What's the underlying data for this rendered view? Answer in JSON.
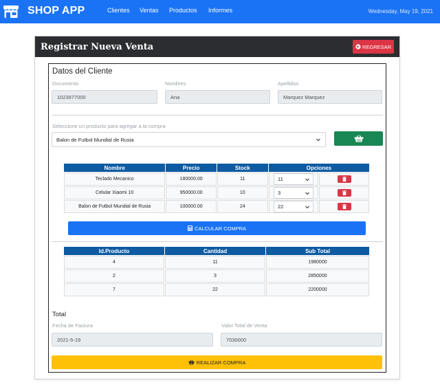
{
  "navbar": {
    "brand": "SHOP APP",
    "links": [
      "Clientes",
      "Ventas",
      "Productos",
      "Informes"
    ],
    "date": "Wednesday, May 19, 2021",
    "color": "#1a73f5"
  },
  "header": {
    "title": "Registrar Nueva Venta",
    "back_label": "REGRESAR"
  },
  "cliente": {
    "title": "Datos del Cliente",
    "documento_label": "Documento",
    "documento_value": "1023977000",
    "nombres_label": "Nombres",
    "nombres_value": "Ana",
    "apellidos_label": "Apellidos",
    "apellidos_value": "Marquez Marquez"
  },
  "producto_select": {
    "label": "Seleccione un producto para agregar a la compra",
    "selected": "Balon de Futbol Mundial de Rusia"
  },
  "productos_table": {
    "headers": [
      "Nombre",
      "Precio",
      "Stock",
      "Opciones"
    ],
    "rows": [
      {
        "nombre": "Teclado Mecanico",
        "precio": "180000.00",
        "stock": "11",
        "cantidad": "11"
      },
      {
        "nombre": "Celular Xiaomi 10",
        "precio": "950000.00",
        "stock": "10",
        "cantidad": "3"
      },
      {
        "nombre": "Balon de Futbol Mundial de Rusia",
        "precio": "100000.00",
        "stock": "24",
        "cantidad": "22"
      }
    ]
  },
  "calc_label": "CALCULAR COMPRA",
  "resumen_table": {
    "headers": [
      "Id.Producto",
      "Cantidad",
      "Sub Total"
    ],
    "rows": [
      {
        "id": "4",
        "cantidad": "11",
        "subtotal": "1980000"
      },
      {
        "id": "2",
        "cantidad": "3",
        "subtotal": "2850000"
      },
      {
        "id": "7",
        "cantidad": "22",
        "subtotal": "2200000"
      }
    ]
  },
  "total": {
    "title": "Total",
    "fecha_label": "Fecha de Factura",
    "fecha_value": "2021-5-19",
    "valor_label": "Valor Total de Venta",
    "valor_value": "7030000"
  },
  "buy_label": "REALIZAR COMPRA",
  "colors": {
    "danger": "#dc3545",
    "success": "#198754",
    "warning": "#ffc107",
    "table_header": "#0e5ba3",
    "dark_header": "#2b2d31"
  }
}
